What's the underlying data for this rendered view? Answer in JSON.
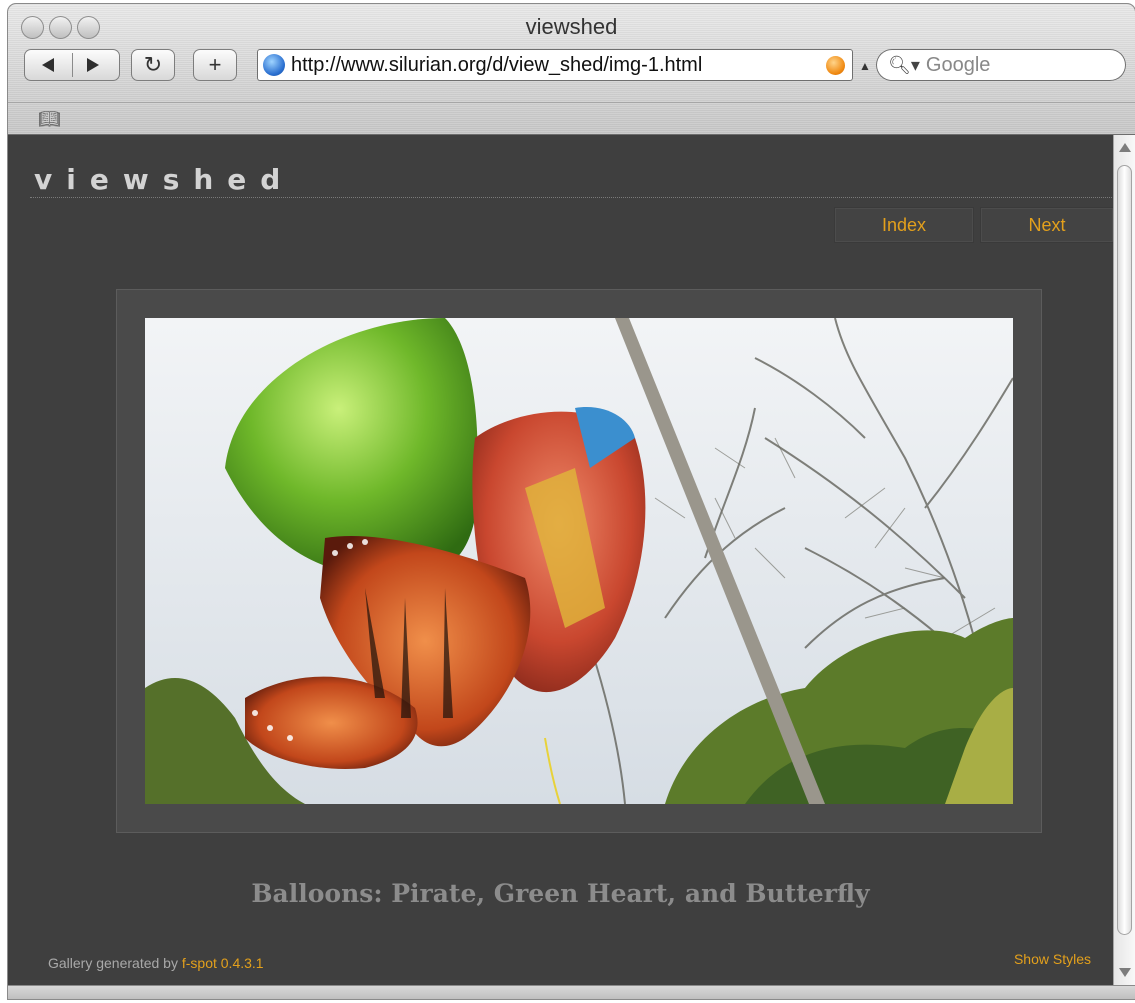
{
  "window": {
    "title": "viewshed"
  },
  "toolbar": {
    "url": "http://www.silurian.org/d/view_shed/img-1.html",
    "search_placeholder": "Google",
    "reload_glyph": "C",
    "add_glyph": "+"
  },
  "site": {
    "logo": "viewshed",
    "nav": {
      "index": "Index",
      "next": "Next"
    },
    "caption": "Balloons: Pirate, Green Heart, and Butterfly",
    "footer": {
      "generated_by": "Gallery generated by ",
      "generator": "f-spot 0.4.3.1",
      "show_styles": "Show Styles"
    }
  },
  "colors": {
    "accent": "#e3a01c",
    "page_bg": "#3f3f3f",
    "caption": "#8c8c8c"
  },
  "icons": [
    "back-icon",
    "forward-icon",
    "reload-icon",
    "add-bookmark-icon",
    "globe-icon",
    "rss-icon",
    "search-icon",
    "bookmarks-book-icon"
  ]
}
